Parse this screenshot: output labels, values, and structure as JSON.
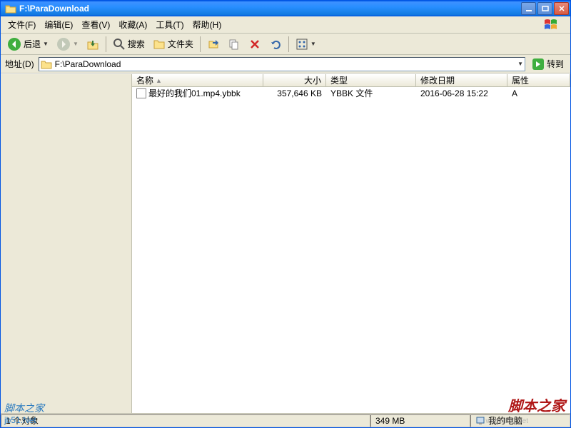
{
  "window": {
    "title": "F:\\ParaDownload"
  },
  "menu": {
    "file": "文件(F)",
    "edit": "编辑(E)",
    "view": "查看(V)",
    "fav": "收藏(A)",
    "tools": "工具(T)",
    "help": "帮助(H)"
  },
  "toolbar": {
    "back": "后退",
    "search": "搜索",
    "folders": "文件夹"
  },
  "address": {
    "label": "地址(D)",
    "path": "F:\\ParaDownload",
    "go": "转到"
  },
  "columns": {
    "name": "名称",
    "size": "大小",
    "type": "类型",
    "date": "修改日期",
    "attr": "属性"
  },
  "files": [
    {
      "name": "最好的我们01.mp4.ybbk",
      "size": "357,646 KB",
      "type": "YBBK 文件",
      "date": "2016-06-28 15:22",
      "attr": "A"
    }
  ],
  "status": {
    "objects": "1 个对象",
    "size": "349 MB",
    "location": "我的电脑"
  },
  "watermarks": {
    "w1a": "脚本之家",
    "w1b": "jb51.Net",
    "w2": "脚本之家",
    "w3": "www.jb51.net"
  }
}
